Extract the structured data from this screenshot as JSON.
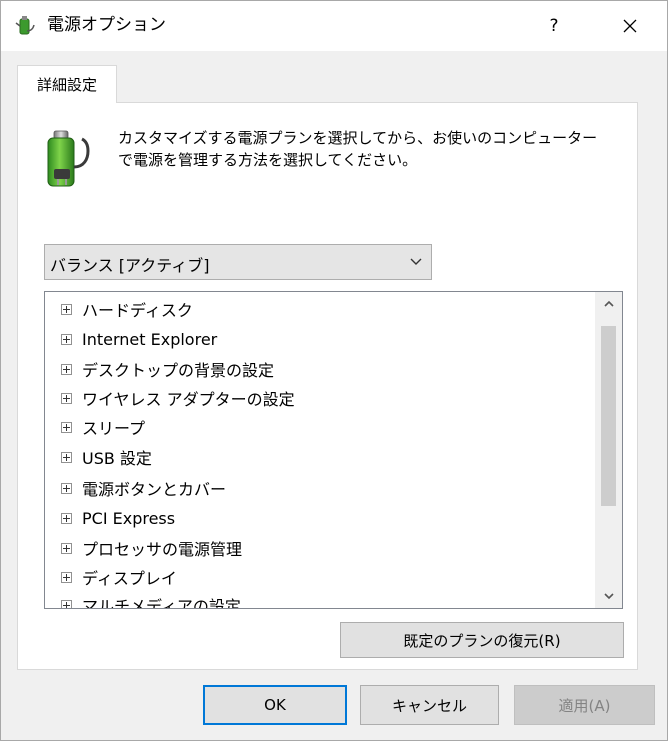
{
  "window": {
    "title": "電源オプション",
    "help_label": "?",
    "close_label": "✕"
  },
  "tab": {
    "label": "詳細設定"
  },
  "description": {
    "line1": "カスタマイズする電源プランを選択してから、お使いのコンピューター",
    "line2": "で電源を管理する方法を選択してください。"
  },
  "plan_select": {
    "value": "バランス [アクティブ]"
  },
  "tree": {
    "items": [
      "ハードディスク",
      "Internet Explorer",
      "デスクトップの背景の設定",
      "ワイヤレス アダプターの設定",
      "スリープ",
      "USB 設定",
      "電源ボタンとカバー",
      "PCI Express",
      "プロセッサの電源管理",
      "ディスプレイ",
      "マルチメディアの設定"
    ]
  },
  "buttons": {
    "restore": "既定のプランの復元(R)",
    "ok": "OK",
    "cancel": "キャンセル",
    "apply": "適用(A)"
  },
  "colors": {
    "focus_border": "#0078d7",
    "disabled_text": "#838383"
  }
}
